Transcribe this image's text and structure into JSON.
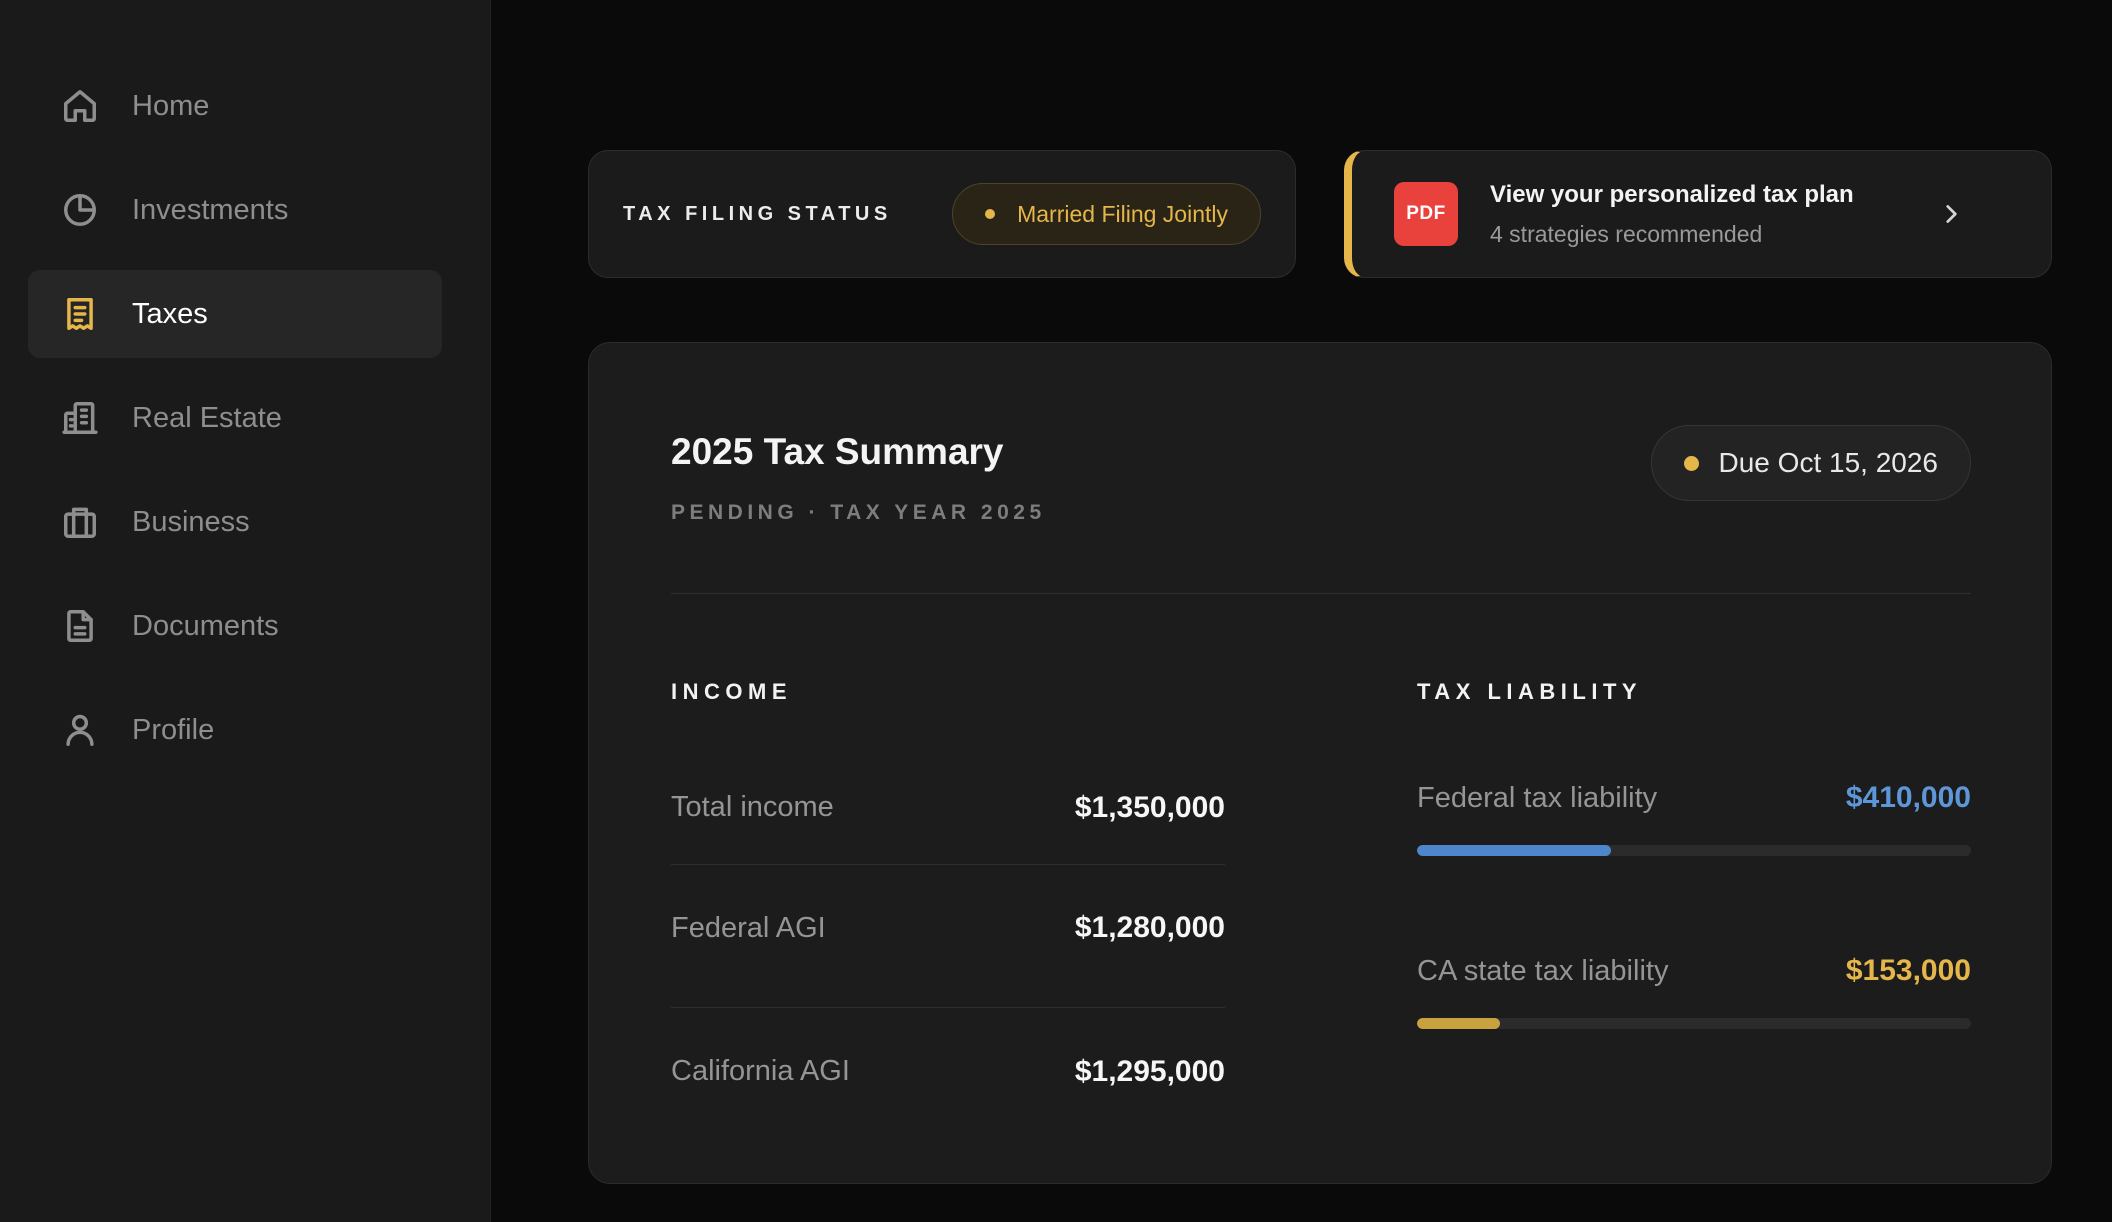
{
  "sidebar": {
    "items": [
      {
        "label": "Home",
        "icon": "home-icon",
        "active": false
      },
      {
        "label": "Investments",
        "icon": "pie-chart-icon",
        "active": false
      },
      {
        "label": "Taxes",
        "icon": "receipt-icon",
        "active": true
      },
      {
        "label": "Real Estate",
        "icon": "building-icon",
        "active": false
      },
      {
        "label": "Business",
        "icon": "briefcase-icon",
        "active": false
      },
      {
        "label": "Documents",
        "icon": "document-icon",
        "active": false
      },
      {
        "label": "Profile",
        "icon": "user-icon",
        "active": false
      }
    ]
  },
  "filing_status": {
    "label": "TAX FILING STATUS",
    "value": "Married Filing Jointly"
  },
  "tax_plan": {
    "badge": "PDF",
    "title": "View your personalized tax plan",
    "subtitle": "4 strategies recommended"
  },
  "summary": {
    "title": "2025 Tax Summary",
    "subtitle": "PENDING · TAX YEAR 2025",
    "due": "Due Oct 15, 2026",
    "income": {
      "label": "INCOME",
      "rows": [
        {
          "label": "Total income",
          "value": "$1,350,000"
        },
        {
          "label": "Federal AGI",
          "value": "$1,280,000"
        },
        {
          "label": "California AGI",
          "value": "$1,295,000"
        }
      ]
    },
    "tax_liability": {
      "label": "TAX LIABILITY",
      "items": [
        {
          "label": "Federal tax liability",
          "value": "$410,000",
          "fraction": 0.35,
          "color": "#5e97d8",
          "bar_color": "#4e86cc"
        },
        {
          "label": "CA state tax liability",
          "value": "$153,000",
          "fraction": 0.15,
          "color": "#e5b64a",
          "bar_color": "#c9a240"
        }
      ]
    }
  },
  "colors": {
    "accent": "#e5b64a",
    "pdf": "#e9413c",
    "background": "#0a0a0a",
    "sidebar": "#1a1a1a"
  }
}
